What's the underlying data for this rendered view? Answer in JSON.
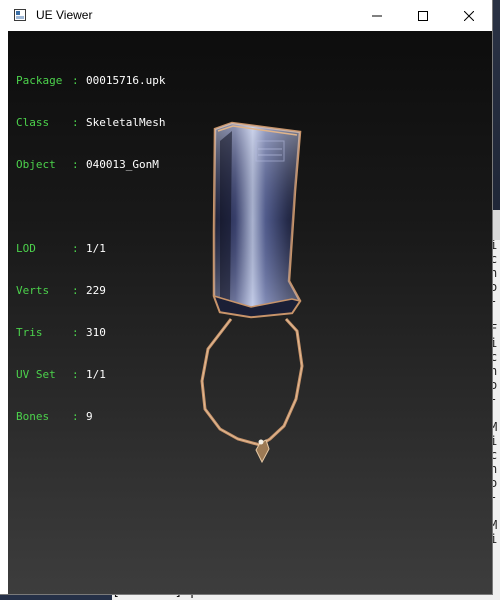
{
  "window": {
    "title": "UE Viewer"
  },
  "info": {
    "package_key": "Package",
    "package_value": "00015716.upk",
    "class_key": "Class",
    "class_value": "SkeletalMesh",
    "object_key": "Object",
    "object_value": "040013_GonM",
    "lod_key": "LOD",
    "lod_value": "1/1",
    "verts_key": "Verts",
    "verts_value": "229",
    "tris_key": "Tris",
    "tris_value": "310",
    "uvset_key": "UV Set",
    "uvset_value": "1/1",
    "bones_key": "Bones",
    "bones_value": "9"
  },
  "background": {
    "left_char": "M",
    "console_lines": [
      "",
      "",
      "i",
      "c",
      "h",
      "o",
      "-",
      "",
      "F",
      "i",
      "c",
      "h",
      "o",
      "-",
      "",
      "M",
      "i",
      "c",
      "h",
      "o",
      "-",
      "",
      "M",
      "i"
    ],
    "bottom_text": "[RstUtil] process \"screenshot.cmd\" exited with c"
  },
  "colors": {
    "label_green": "#4cd24c",
    "value_white": "#ffffff",
    "viewport_top": "#0d0d0d",
    "viewport_bottom": "#3d3d3d"
  }
}
